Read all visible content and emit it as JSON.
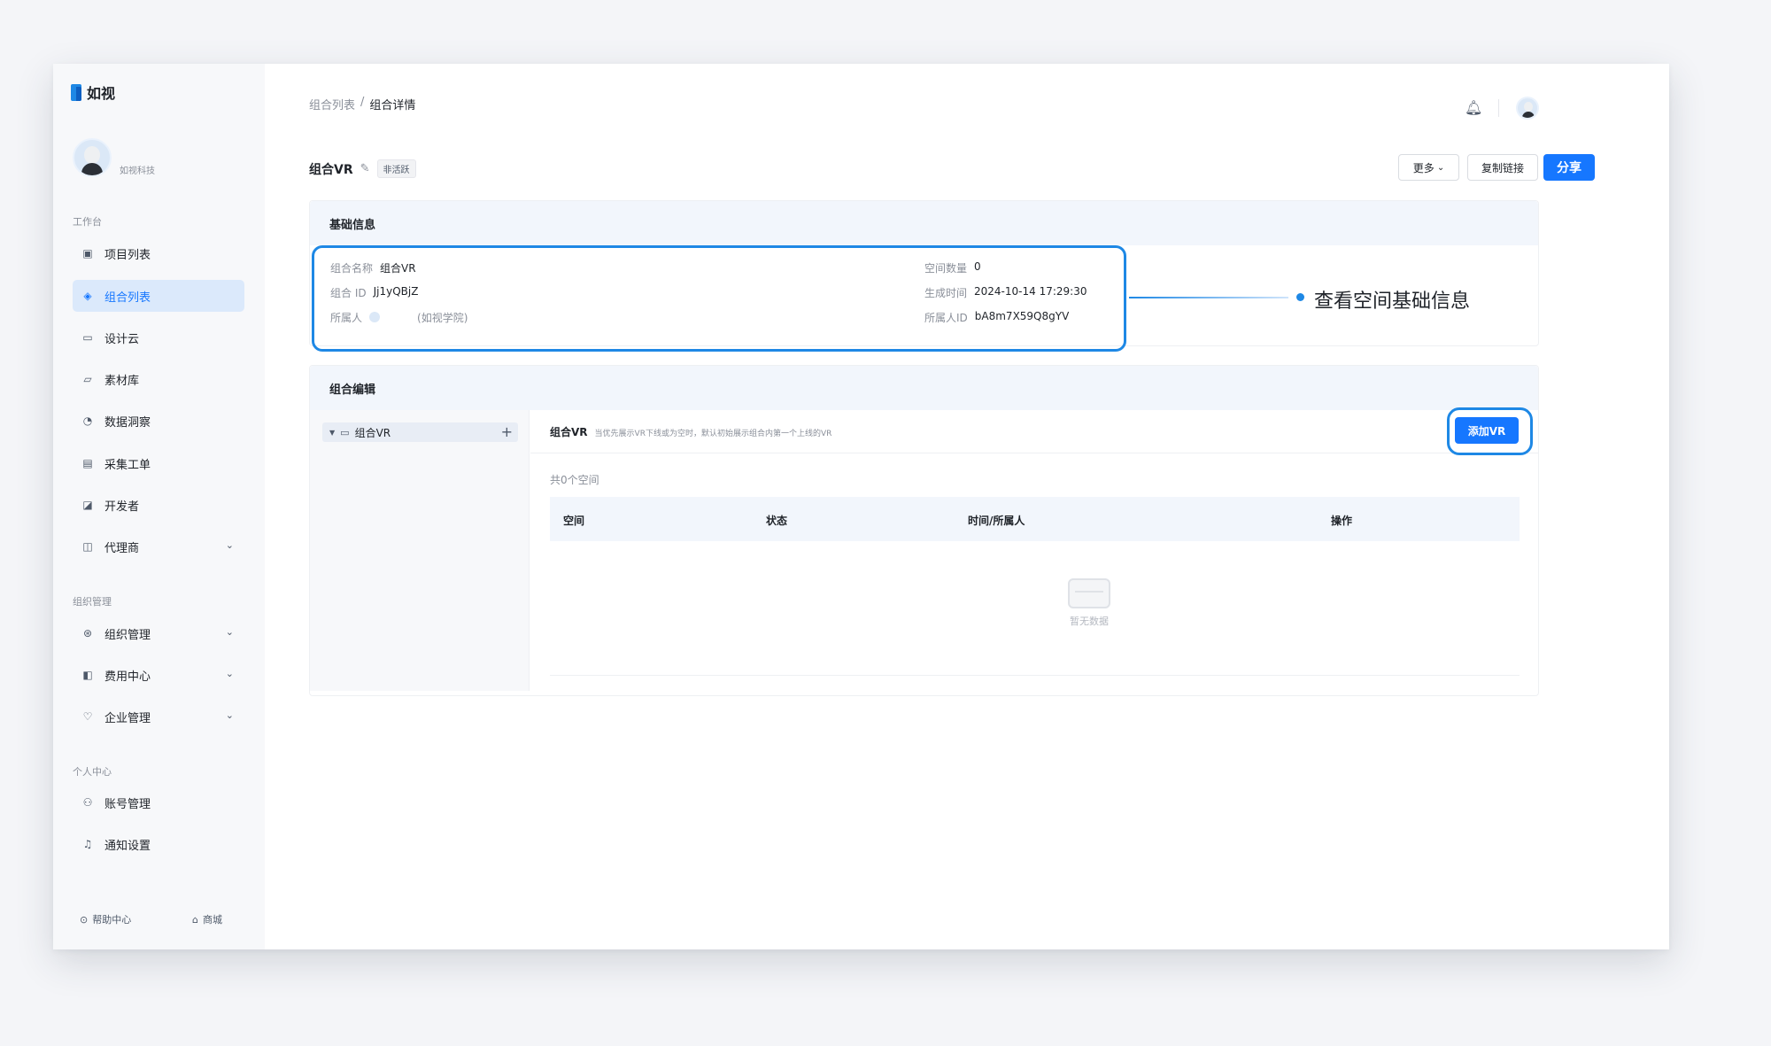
{
  "app": {
    "logo_text": "如视",
    "company": "如视科技"
  },
  "colors": {
    "accent": "#1677ff",
    "highlight": "#1e88e5",
    "sidebar_active_bg": "#dbe9fb"
  },
  "sidebar": {
    "sections": {
      "workspace": "工作台",
      "org": "组织管理",
      "personal": "个人中心"
    },
    "items": [
      {
        "label": "项目列表",
        "icon": "vr-box-icon"
      },
      {
        "label": "组合列表",
        "icon": "layers-icon",
        "active": true
      },
      {
        "label": "设计云",
        "icon": "monitor-icon"
      },
      {
        "label": "素材库",
        "icon": "folder-icon"
      },
      {
        "label": "数据洞察",
        "icon": "pie-chart-icon"
      },
      {
        "label": "采集工单",
        "icon": "document-icon"
      },
      {
        "label": "开发者",
        "icon": "code-icon"
      },
      {
        "label": "代理商",
        "icon": "briefcase-icon"
      },
      {
        "label": "组织管理",
        "icon": "org-icon"
      },
      {
        "label": "费用中心",
        "icon": "wallet-icon"
      },
      {
        "label": "企业管理",
        "icon": "shield-icon"
      },
      {
        "label": "账号管理",
        "icon": "user-icon"
      },
      {
        "label": "通知设置",
        "icon": "bell-icon"
      }
    ],
    "footer": {
      "help": "帮助中心",
      "store": "商城"
    }
  },
  "header": {
    "breadcrumb": [
      "组合列表",
      "组合详情"
    ],
    "breadcrumb_sep": "/"
  },
  "title": {
    "name": "组合VR",
    "status": "非活跃"
  },
  "actions": {
    "more": "更多",
    "copy_link": "复制链接",
    "share": "分享"
  },
  "basic_info": {
    "heading": "基础信息",
    "name_key": "组合名称",
    "name_val": "组合VR",
    "id_key": "组合 ID",
    "id_val": "Jj1yQBjZ",
    "owner_key": "所属人",
    "owner_val": "(如视学院)",
    "space_count_key": "空间数量",
    "space_count_val": "0",
    "created_key": "生成时间",
    "created_val": "2024-10-14 17:29:30",
    "owner_id_key": "所属人ID",
    "owner_id_val": "bA8m7X59Q8gYV",
    "callout": "查看空间基础信息"
  },
  "edit": {
    "heading": "组合编辑",
    "tree_item": "组合VR",
    "detail_title": "组合VR",
    "detail_hint": "当优先展示VR下线或为空时，默认初始展示组合内第一个上线的VR",
    "add_button": "添加VR",
    "count": "共0个空间",
    "columns": [
      "空间",
      "状态",
      "时间/所属人",
      "操作"
    ],
    "empty_text": "暂无数据"
  }
}
